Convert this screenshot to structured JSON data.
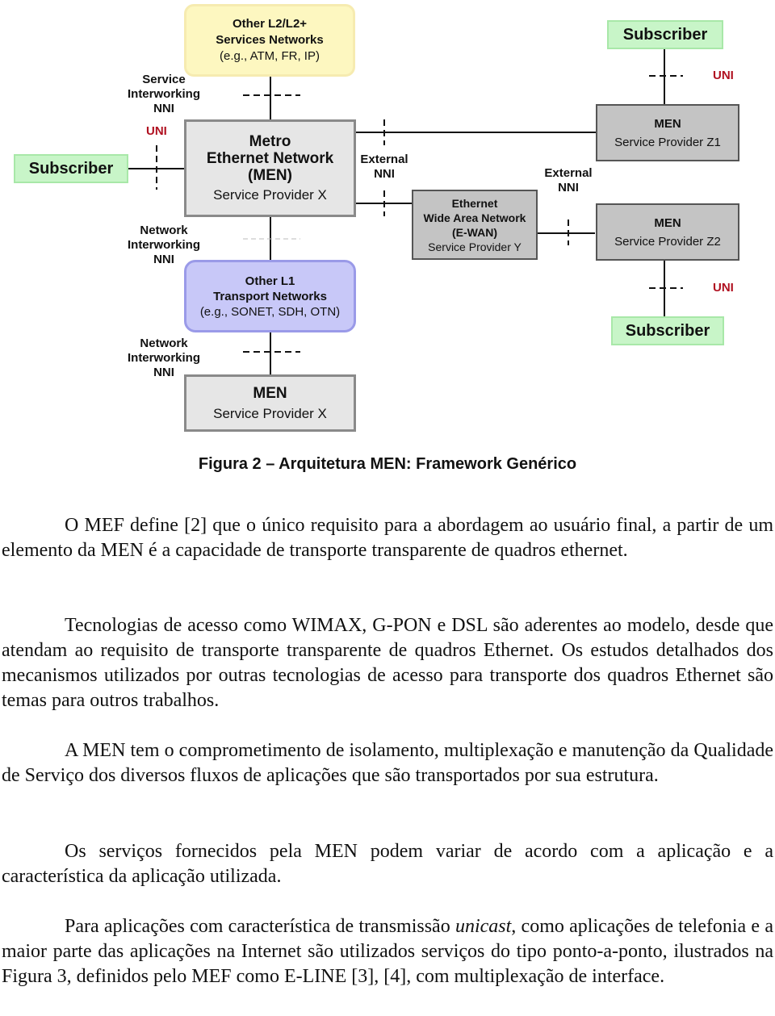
{
  "diagram": {
    "subscriber_left": "Subscriber",
    "subscriber_top_right": "Subscriber",
    "subscriber_bottom_right": "Subscriber",
    "other_l2": {
      "line1": "Other L2/L2+",
      "line2": "Services Networks",
      "line3": "(e.g., ATM, FR, IP)"
    },
    "men_main": {
      "line1": "Metro",
      "line2": "Ethernet Network",
      "line3": "(MEN)",
      "line4": "Service Provider X"
    },
    "other_l1": {
      "line1": "Other L1",
      "line2": "Transport Networks",
      "line3": "(e.g., SONET, SDH, OTN)"
    },
    "men_bottom": {
      "line1": "MEN",
      "line2": "Service Provider X"
    },
    "ewan": {
      "line1": "Ethernet",
      "line2": "Wide Area Network",
      "line3": "(E-WAN)",
      "line4": "Service Provider Y"
    },
    "men_z1": {
      "line1": "MEN",
      "line2": "Service Provider Z1"
    },
    "men_z2": {
      "line1": "MEN",
      "line2": "Service Provider Z2"
    },
    "labels": {
      "service_interworking_nni": [
        "Service",
        "Interworking",
        "NNI"
      ],
      "network_interworking_nni_1": [
        "Network",
        "Interworking",
        "NNI"
      ],
      "network_interworking_nni_2": [
        "Network",
        "Interworking",
        "NNI"
      ],
      "external_nni_1": [
        "External",
        "NNI"
      ],
      "external_nni_2": [
        "External",
        "NNI"
      ],
      "uni_left": "UNI",
      "uni_top_right": "UNI",
      "uni_bottom_right": "UNI"
    },
    "colors": {
      "subscriber_fill": "#c8f5c8",
      "men_fill": "#e6e6e6",
      "provider_fill": "#c4c4c4",
      "l2_fill": "#fdf7c0",
      "l1_fill": "#c8c8f8",
      "uni_text": "#b01020"
    }
  },
  "caption": "Figura 2 – Arquitetura MEN: Framework Genérico",
  "paragraphs": [
    "O MEF define [2] que o único requisito para a abordagem ao usuário final, a partir de um elemento da MEN é a capacidade de transporte transparente de quadros ethernet.",
    "Tecnologias de acesso como WIMAX, G-PON e DSL são aderentes ao modelo, desde que atendam ao requisito de transporte transparente de quadros Ethernet. Os estudos detalhados dos mecanismos utilizados por outras tecnologias de acesso para transporte dos quadros Ethernet são temas para outros trabalhos.",
    "A MEN tem o comprometimento de isolamento, multiplexação e manutenção da Qualidade de Serviço dos diversos fluxos de aplicações que são transportados por sua estrutura.",
    "Os serviços fornecidos pela MEN podem variar de acordo com a aplicação e a característica da aplicação utilizada."
  ],
  "last_paragraph": {
    "before": "Para aplicações com característica de transmissão ",
    "italic": "unicast",
    "after": ", como aplicações de telefonia e a maior parte das aplicações na Internet são utilizados serviços do tipo ponto-a-ponto, ilustrados na Figura 3, definidos pelo MEF como E-LINE [3], [4], com multiplexação de interface."
  }
}
